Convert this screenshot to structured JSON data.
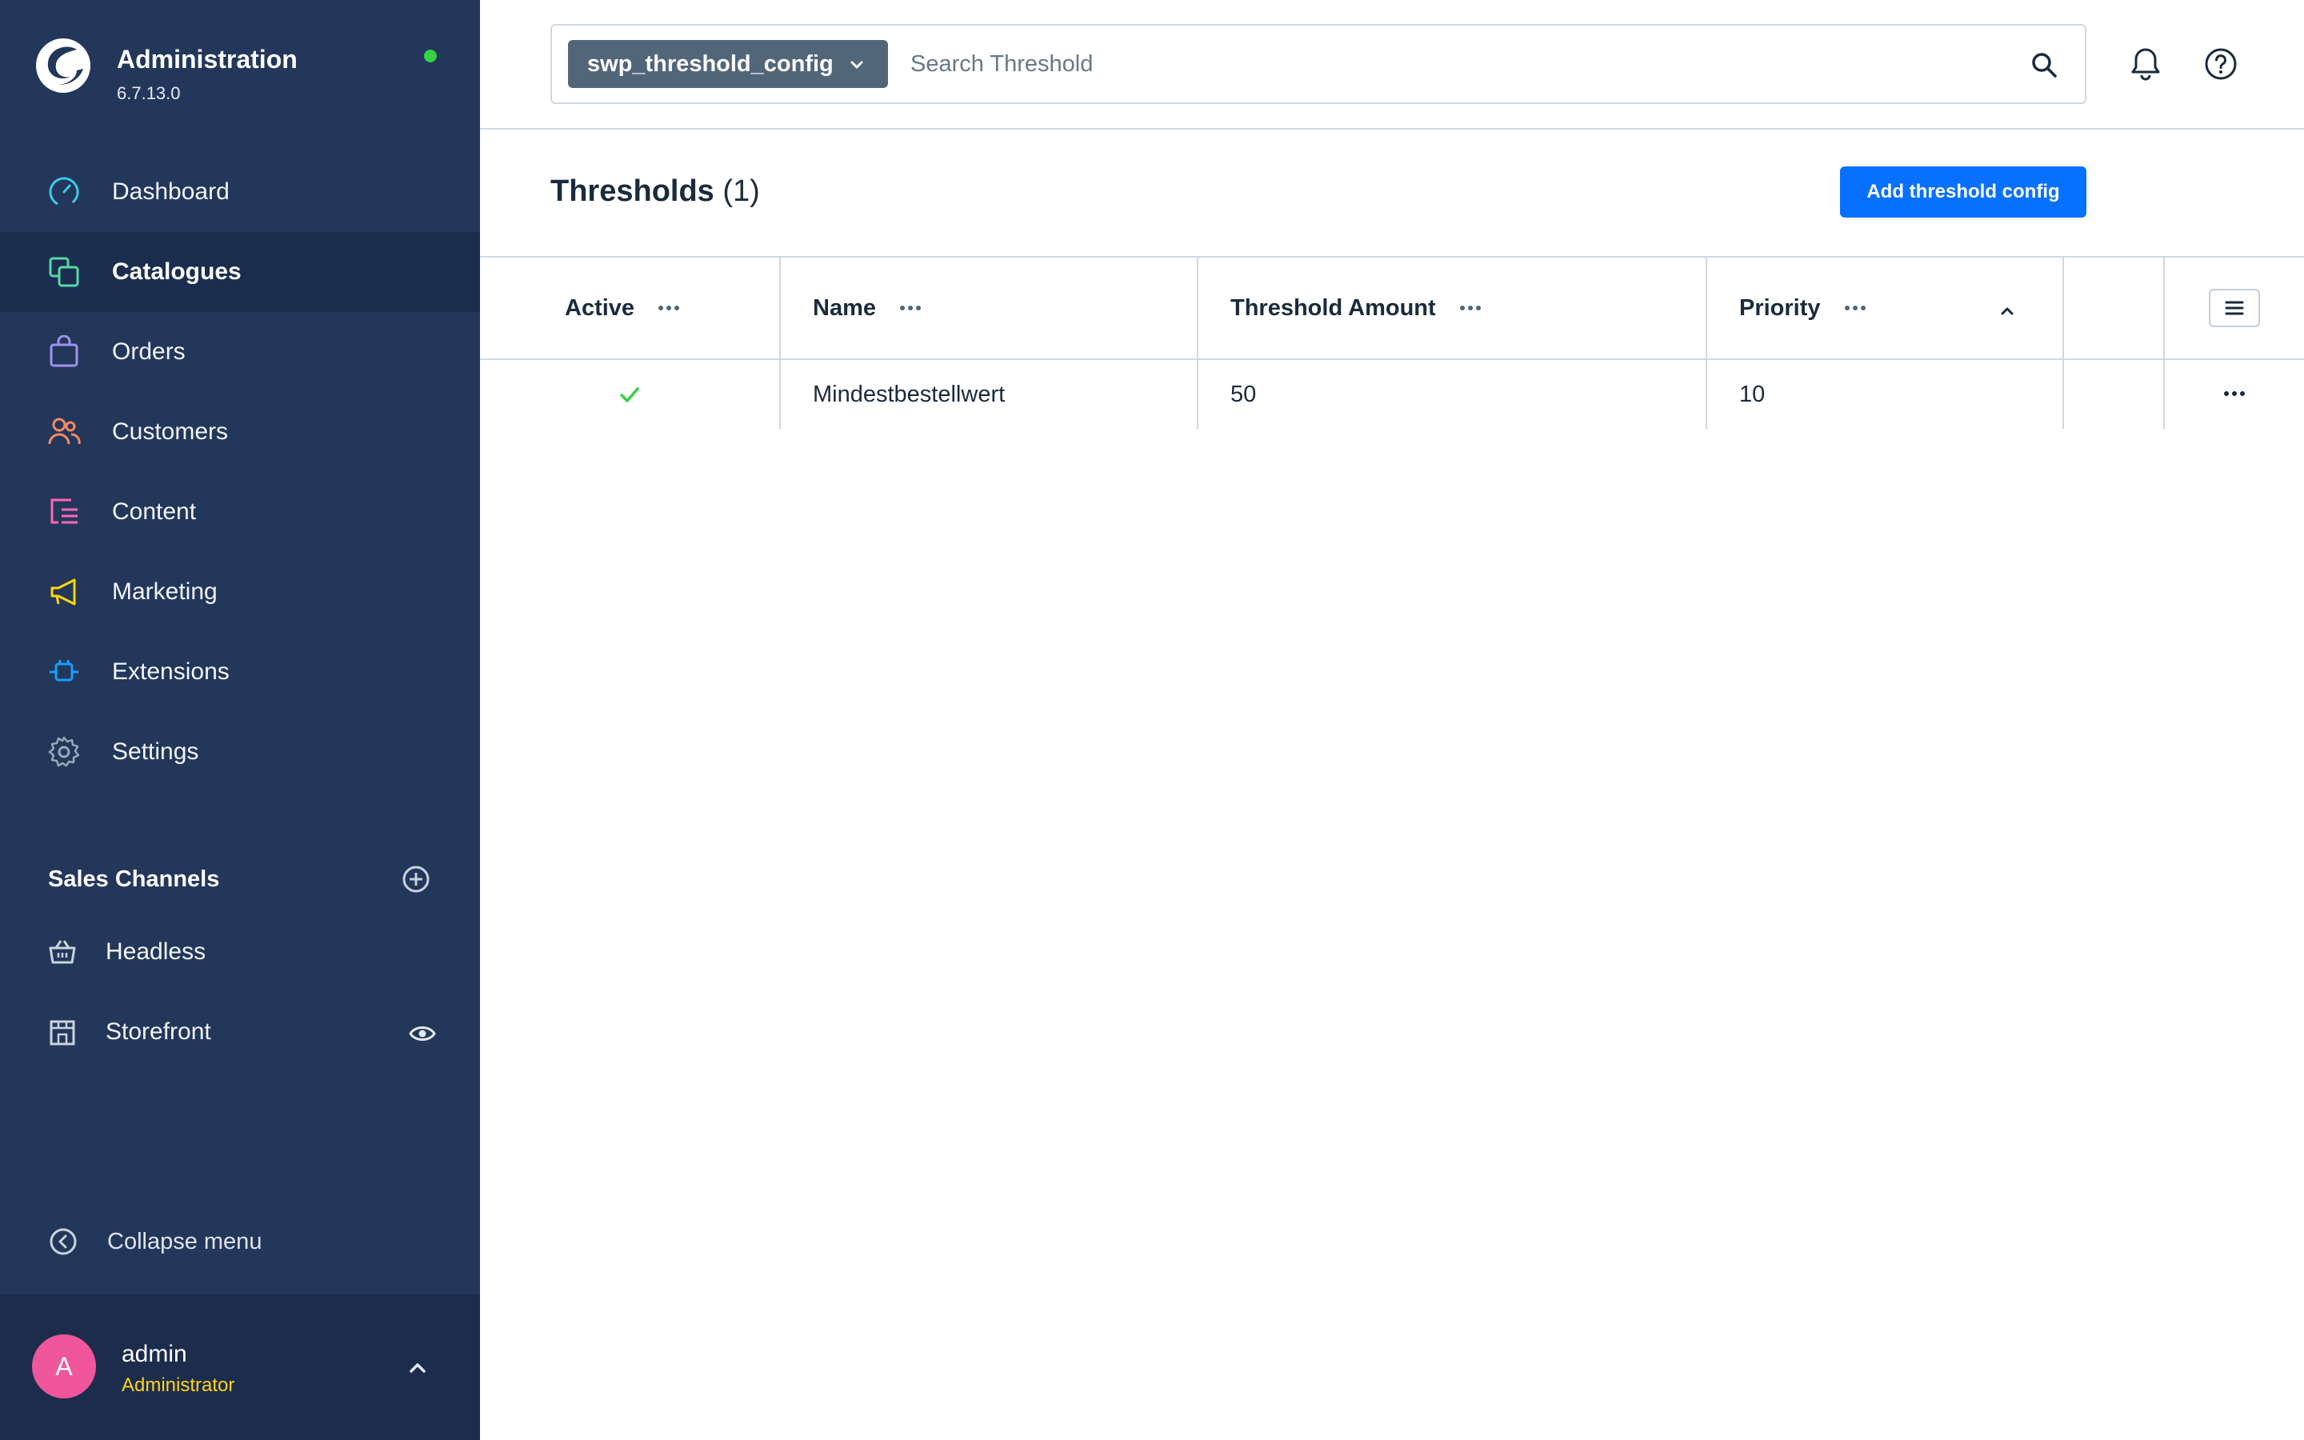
{
  "app": {
    "title": "Administration",
    "version": "6.7.13.0"
  },
  "sidebar": {
    "items": [
      {
        "label": "Dashboard",
        "icon": "dashboard-icon",
        "color": "#3fc7e8"
      },
      {
        "label": "Catalogues",
        "icon": "catalogues-icon",
        "color": "#57d9a3",
        "active": true
      },
      {
        "label": "Orders",
        "icon": "orders-icon",
        "color": "#a092f0"
      },
      {
        "label": "Customers",
        "icon": "customers-icon",
        "color": "#f88962"
      },
      {
        "label": "Content",
        "icon": "content-icon",
        "color": "#ff68b4"
      },
      {
        "label": "Marketing",
        "icon": "marketing-icon",
        "color": "#ffd700"
      },
      {
        "label": "Extensions",
        "icon": "extensions-icon",
        "color": "#189eff"
      },
      {
        "label": "Settings",
        "icon": "settings-icon",
        "color": "#9aa8b5"
      }
    ],
    "sales_channels": {
      "title": "Sales Channels",
      "items": [
        {
          "label": "Headless",
          "icon": "basket-icon"
        },
        {
          "label": "Storefront",
          "icon": "storefront-icon"
        }
      ]
    },
    "collapse_label": "Collapse menu"
  },
  "user": {
    "initial": "A",
    "name": "admin",
    "role": "Administrator"
  },
  "search": {
    "entity": "swp_threshold_config",
    "placeholder": "Search Threshold"
  },
  "page": {
    "title": "Thresholds",
    "count": "(1)",
    "add_button": "Add threshold config"
  },
  "grid": {
    "columns": [
      "Active",
      "Name",
      "Threshold Amount",
      "Priority"
    ],
    "rows": [
      {
        "active": true,
        "name": "Mindestbestellwert",
        "threshold_amount": "50",
        "priority": "10"
      }
    ]
  },
  "colors": {
    "sidebar_bg": "#22375a",
    "accent": "#0870ff",
    "active_check": "#37d046"
  }
}
